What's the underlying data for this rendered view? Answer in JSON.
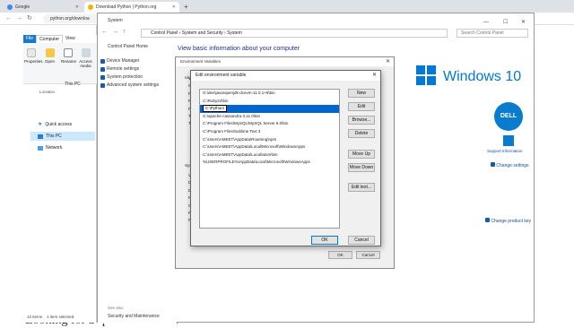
{
  "browser": {
    "tabs": [
      {
        "label": "Google",
        "favicon_color": "#4285f4",
        "active": false
      },
      {
        "label": "Download Python | Python.org",
        "favicon_color": "#f4b400",
        "active": true
      }
    ],
    "new_tab": "+",
    "url": "python.org/downloa"
  },
  "explorer": {
    "ribbon_tabs": [
      "File",
      "Computer",
      "View"
    ],
    "ribbon_buttons": [
      "Properties",
      "Open",
      "Rename",
      "Access media"
    ],
    "location_group": "Location",
    "address": "This PC",
    "nav": [
      "Quick access",
      "This PC",
      "Network"
    ],
    "status": [
      "12 items",
      "1 item selected"
    ]
  },
  "system_window": {
    "title": "System",
    "breadcrumb": [
      "Control Panel",
      "System and Security",
      "System"
    ],
    "search_placeholder": "Search Control Panel",
    "sidebar_home": "Control Panel Home",
    "sidebar_links": [
      "Device Manager",
      "Remote settings",
      "System protection",
      "Advanced system settings"
    ],
    "heading": "View basic information about your computer",
    "windows_logo_text": "Windows 10",
    "oem_logo": "DELL",
    "support_info": "Support Information",
    "change_settings": "Change settings",
    "change_product_key": "Change product key",
    "see_also": "See also",
    "security_maintenance": "Security and Maintenance"
  },
  "env_dialog": {
    "title": "Environment Variables",
    "user_section_label": "Use",
    "user_rows": [
      "Va",
      "O",
      "Pa",
      "Ru",
      "Pa",
      "TE",
      "TM"
    ],
    "system_section_label": "Syste",
    "system_rows": [
      "Va",
      "De",
      "DR",
      "NU",
      "OS",
      "Pa",
      "PA"
    ],
    "ok_label": "OK",
    "cancel_label": "Cancel"
  },
  "edit_dialog": {
    "title": "Edit environment variable",
    "selected_index": 2,
    "entries": [
      "G:\\dev\\java\\openjdk-dcevm-11.0.1+8\\bin",
      "C:\\Ruby24\\bin",
      "C:\\Python\\",
      "G:\\apache-cassandra-3.11.0\\bin",
      "C:\\Program Files\\MySQL\\MySQL Server 8.0\\bin",
      "C:\\Program Files\\Sublime Text 3",
      "C:\\Users\\AMEET\\AppData\\Roaming\\npm",
      "C:\\Users\\AMEET\\AppData\\Local\\Microsoft\\WindowsApps",
      "C:\\Users\\AMEET\\AppData\\Local\\atom\\bin",
      "%USERPROFILE%\\AppData\\Local\\Microsoft\\WindowsApps",
      "",
      "",
      "",
      "",
      "",
      "",
      ""
    ],
    "buttons": {
      "new": "New",
      "edit": "Edit",
      "browse": "Browse...",
      "delete": "Delete",
      "move_up": "Move Up",
      "move_down": "Move Down",
      "edit_text": "Edit text...",
      "ok": "OK",
      "cancel": "Cancel"
    }
  },
  "python_page": {
    "partial_text": "Looking for a specific release?"
  },
  "colors": {
    "windows_blue": "#0078d7",
    "link_blue": "#1a4a9a",
    "selection_blue": "#0066cc"
  }
}
